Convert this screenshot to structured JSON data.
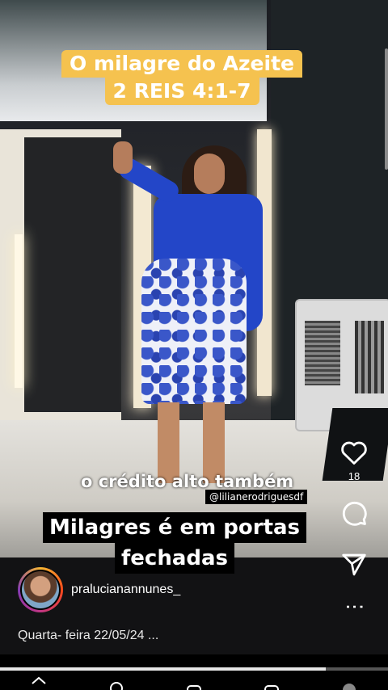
{
  "video": {
    "title_line1": "O milagre do Azeite",
    "title_line2": "2 REIS 4:1-7",
    "caption": "o crédito alto também",
    "handle_tag": "@lilianerodriguesdf",
    "subtitle_line1": "Milagres é em portas",
    "subtitle_line2": "fechadas"
  },
  "actions": {
    "like_icon": "heart-icon",
    "likes": "18",
    "comment_icon": "comment-bubble-icon",
    "share_icon": "send-icon",
    "more_icon": "more-vertical-icon",
    "more": "⋮"
  },
  "author": {
    "username": "pralucianannunes_"
  },
  "description": "Quarta- feira 22/05/24 ...",
  "progress": 0.84,
  "nav": [
    "home-icon",
    "search-icon",
    "add-icon",
    "reels-icon",
    "profile-icon"
  ],
  "colors": {
    "title_bg": "#f5c24f",
    "subtitle_bg": "#000000"
  }
}
